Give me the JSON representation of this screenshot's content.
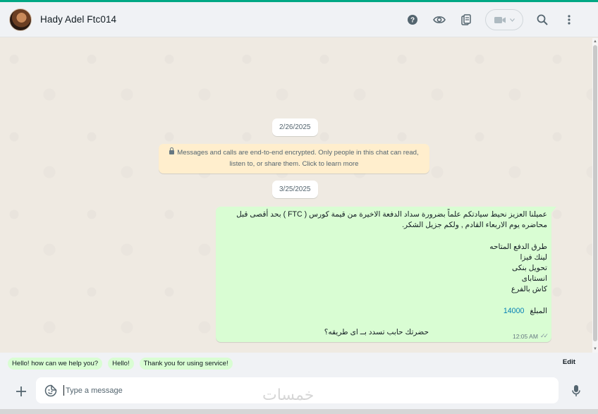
{
  "header": {
    "contact_name": "Hady Adel Ftc014",
    "icons": [
      "help-icon",
      "view-once-icon",
      "clipboard-icon",
      "video-call-icon",
      "chevron-down-icon",
      "search-icon",
      "menu-icon"
    ]
  },
  "chat": {
    "date_1": "2/26/2025",
    "encryption_notice_1": "Messages and calls are end-to-end encrypted. Only people in this chat can read,",
    "encryption_notice_2": "listen to, or share them. Click to learn more",
    "date_2": "3/25/2025",
    "message": {
      "lines": [
        "عميلنا العزيز نحيط سيادتكم علماً بضرورة سداد الدفعة الاخيرة من قيمة كورس ( FTC ) بحد أقصى قبل",
        "محاضره يوم الاربعاء  القادم , ولكم جزيل الشكر.",
        "",
        "طرق الدفع المتاحه",
        "لينك  فيزا",
        "تحويل بنكى",
        "انستاباى",
        "كاش بالفرع",
        "",
        "المبلغ"
      ],
      "amount": "14000",
      "last_line": "حضرتك حابب تسدد بــ اى طريقه؟",
      "time": "12:05 AM",
      "ticks": "✓✓"
    }
  },
  "quick_replies": [
    "Hello! how can we help you?",
    "Hello!",
    "Thank you for using service!"
  ],
  "edit_label": "Edit",
  "composer": {
    "placeholder": "Type a message",
    "value": ""
  },
  "watermark": "خمسات",
  "colors": {
    "accent": "#00a884",
    "outgoing_bubble": "#d9fdd3",
    "system_notice": "#ffeecd",
    "chat_bg": "#efeae2",
    "panel_bg": "#f0f2f5",
    "link": "#027eb5"
  }
}
